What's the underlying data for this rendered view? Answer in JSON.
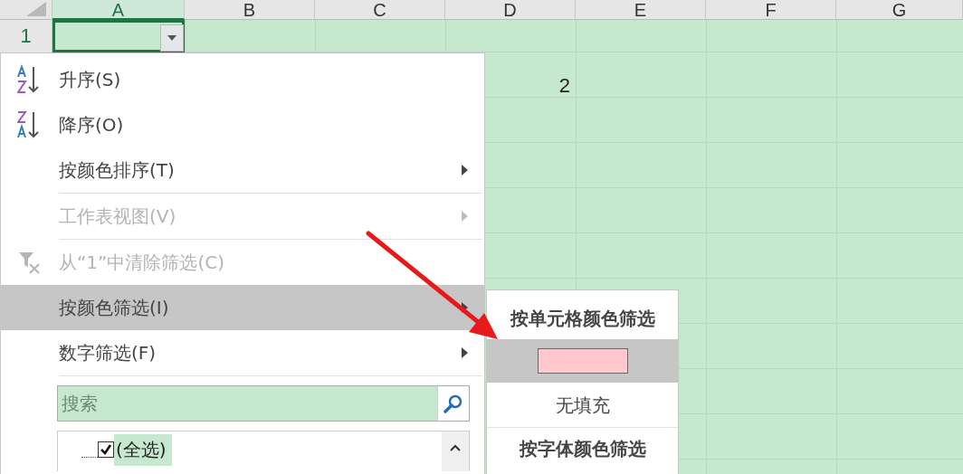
{
  "sheet": {
    "columns": [
      {
        "label": "A",
        "selected": true
      },
      {
        "label": "B",
        "selected": false
      },
      {
        "label": "C",
        "selected": false
      },
      {
        "label": "D",
        "selected": false
      },
      {
        "label": "E",
        "selected": false
      },
      {
        "label": "F",
        "selected": false
      },
      {
        "label": "G",
        "selected": false
      }
    ],
    "row_headers": [
      "1"
    ],
    "cells": [
      {
        "value": "2"
      }
    ]
  },
  "filter_menu": {
    "items": [
      {
        "kind": "item",
        "label": "升序(S)",
        "disabled": false,
        "submenu": false,
        "selected": false
      },
      {
        "kind": "item",
        "label": "降序(O)",
        "disabled": false,
        "submenu": false,
        "selected": false
      },
      {
        "kind": "item",
        "label": "按颜色排序(T)",
        "disabled": false,
        "submenu": true,
        "selected": false
      },
      {
        "kind": "separator"
      },
      {
        "kind": "item",
        "label": "工作表视图(V)",
        "disabled": true,
        "submenu": true,
        "selected": false
      },
      {
        "kind": "separator"
      },
      {
        "kind": "item",
        "label": "从“1”中清除筛选(C)",
        "disabled": true,
        "submenu": false,
        "selected": false
      },
      {
        "kind": "item",
        "label": "按颜色筛选(I)",
        "disabled": false,
        "submenu": true,
        "selected": true
      },
      {
        "kind": "item",
        "label": "数字筛选(F)",
        "disabled": false,
        "submenu": true,
        "selected": false
      },
      {
        "kind": "separator"
      }
    ],
    "search": {
      "placeholder": "搜索"
    },
    "values": [
      {
        "label": "(全选)",
        "checked": true
      }
    ]
  },
  "color_submenu": {
    "items": [
      {
        "kind": "header",
        "label": "按单元格颜色筛选"
      },
      {
        "kind": "swatch",
        "color": "#ffc7ce",
        "selected": true
      },
      {
        "kind": "option",
        "label": "无填充",
        "selected": false
      },
      {
        "kind": "header",
        "label": "按字体颜色筛选"
      }
    ]
  }
}
